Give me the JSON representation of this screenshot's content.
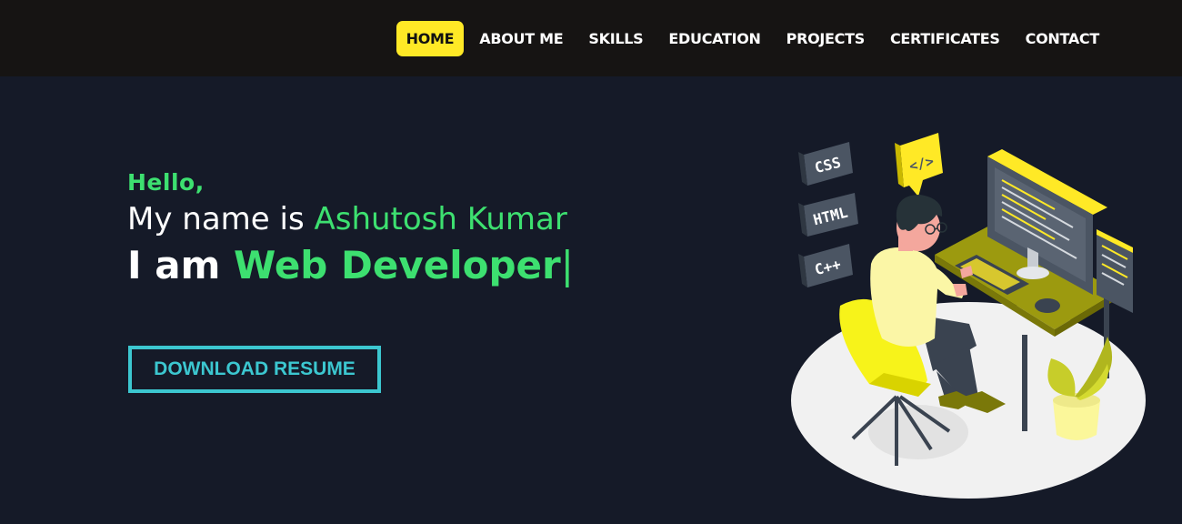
{
  "nav": {
    "items": [
      {
        "label": "HOME",
        "active": true
      },
      {
        "label": "ABOUT ME",
        "active": false
      },
      {
        "label": "SKILLS",
        "active": false
      },
      {
        "label": "EDUCATION",
        "active": false
      },
      {
        "label": "PROJECTS",
        "active": false
      },
      {
        "label": "CERTIFICATES",
        "active": false
      },
      {
        "label": "CONTACT",
        "active": false
      }
    ]
  },
  "hero": {
    "greeting": "Hello,",
    "name_prefix": "My name is ",
    "name": "Ashutosh Kumar",
    "role_prefix": "I am ",
    "role": "Web Developer",
    "cursor": "|",
    "resume_button": "DOWNLOAD RESUME"
  },
  "illustration": {
    "tags": [
      "CSS",
      "HTML",
      "C++"
    ],
    "code_icon": "</>"
  },
  "colors": {
    "background": "#151a28",
    "navbar": "#161413",
    "accent_yellow": "#ffe926",
    "accent_green": "#3de070",
    "button_teal": "#3cc7d0"
  }
}
